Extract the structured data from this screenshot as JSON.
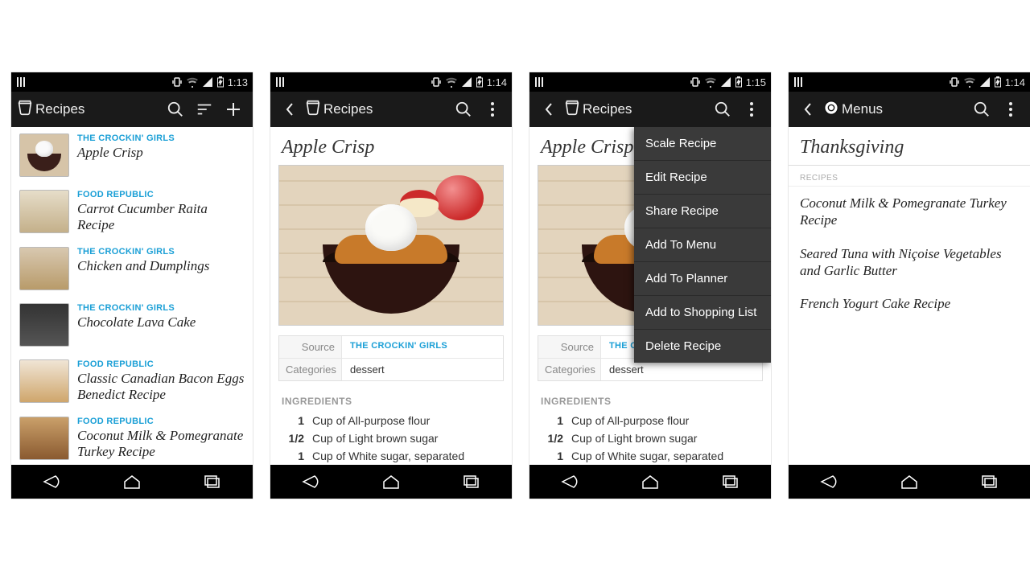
{
  "screens": [
    {
      "time": "1:13",
      "app_title": "Recipes",
      "actions": [
        "search",
        "filter",
        "add"
      ],
      "list": [
        {
          "source": "THE CROCKIN' GIRLS",
          "title": "Apple Crisp",
          "thumb": "crisp"
        },
        {
          "source": "FOOD REPUBLIC",
          "title": "Carrot Cucumber Raita Recipe",
          "thumb": "g1"
        },
        {
          "source": "THE CROCKIN' GIRLS",
          "title": "Chicken and Dumplings",
          "thumb": "g2"
        },
        {
          "source": "THE CROCKIN' GIRLS",
          "title": "Chocolate Lava Cake",
          "thumb": "dark"
        },
        {
          "source": "FOOD REPUBLIC",
          "title": "Classic Canadian Bacon Eggs Benedict Recipe",
          "thumb": "g3"
        },
        {
          "source": "FOOD REPUBLIC",
          "title": "Coconut Milk & Pomegranate Turkey Recipe",
          "thumb": "g4"
        }
      ]
    },
    {
      "time": "1:14",
      "app_title": "Recipes",
      "actions": [
        "search",
        "overflow"
      ],
      "back": true,
      "detail": {
        "title": "Apple Crisp",
        "meta": [
          {
            "label": "Source",
            "value": "THE CROCKIN' GIRLS",
            "link": true
          },
          {
            "label": "Categories",
            "value": "dessert",
            "link": false
          }
        ],
        "ingredients_heading": "INGREDIENTS",
        "ingredients": [
          {
            "qty": "1",
            "text": "Cup of All-purpose flour"
          },
          {
            "qty": "1/2",
            "text": "Cup of Light brown sugar"
          },
          {
            "qty": "1",
            "text": "Cup of White sugar, separated"
          }
        ]
      }
    },
    {
      "time": "1:15",
      "app_title": "Recipes",
      "actions": [
        "search",
        "overflow"
      ],
      "back": true,
      "detail": {
        "title": "Apple Crisp",
        "meta": [
          {
            "label": "Source",
            "value": "THE CRO",
            "link": true
          },
          {
            "label": "Categories",
            "value": "dessert",
            "link": false
          }
        ],
        "ingredients_heading": "INGREDIENTS",
        "ingredients": [
          {
            "qty": "1",
            "text": "Cup of All-purpose flour"
          },
          {
            "qty": "1/2",
            "text": "Cup of Light brown sugar"
          },
          {
            "qty": "1",
            "text": "Cup of White sugar, separated"
          }
        ]
      },
      "overflow_menu": [
        "Scale Recipe",
        "Edit Recipe",
        "Share Recipe",
        "Add To Menu",
        "Add To Planner",
        "Add to Shopping List",
        "Delete Recipe"
      ]
    },
    {
      "time": "1:14",
      "app_title": "Menus",
      "actions": [
        "search",
        "overflow"
      ],
      "back": true,
      "menu": {
        "title": "Thanksgiving",
        "section": "RECIPES",
        "recipes": [
          "Coconut Milk & Pomegranate Turkey Recipe",
          "Seared Tuna with Niçoise Vegetables and Garlic Butter",
          "French Yogurt Cake Recipe"
        ]
      }
    }
  ]
}
